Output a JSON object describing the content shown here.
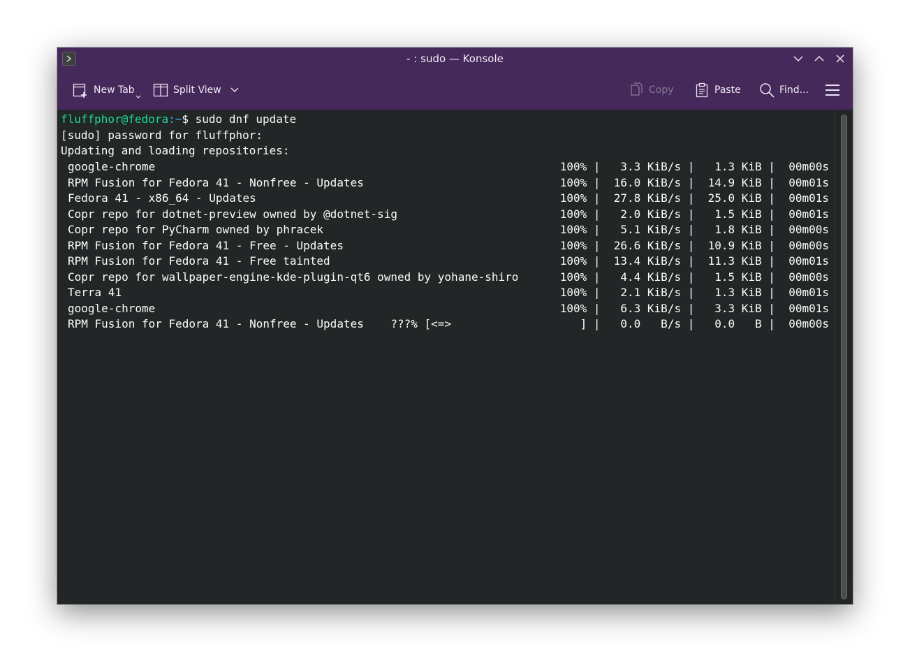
{
  "window": {
    "title": "- : sudo — Konsole"
  },
  "toolbar": {
    "new_tab_label": "New Tab",
    "split_view_label": "Split View",
    "copy_label": "Copy",
    "paste_label": "Paste",
    "find_label": "Find..."
  },
  "terminal": {
    "prompt_user": "fluffphor@fedora",
    "prompt_path": ":~",
    "prompt_symbol": "$",
    "command": " sudo dnf update",
    "line_password": "[sudo] password for fluffphor:",
    "line_updating": "Updating and loading repositories:",
    "repos": [
      {
        "name": "google-chrome",
        "stats": "100% |   3.3 KiB/s |   1.3 KiB |  00m00s"
      },
      {
        "name": "RPM Fusion for Fedora 41 - Nonfree - Updates",
        "stats": "100% |  16.0 KiB/s |  14.9 KiB |  00m01s"
      },
      {
        "name": "Fedora 41 - x86_64 - Updates",
        "stats": "100% |  27.8 KiB/s |  25.0 KiB |  00m01s"
      },
      {
        "name": "Copr repo for dotnet-preview owned by @dotnet-sig",
        "stats": "100% |   2.0 KiB/s |   1.5 KiB |  00m01s"
      },
      {
        "name": "Copr repo for PyCharm owned by phracek",
        "stats": "100% |   5.1 KiB/s |   1.8 KiB |  00m00s"
      },
      {
        "name": "RPM Fusion for Fedora 41 - Free - Updates",
        "stats": "100% |  26.6 KiB/s |  10.9 KiB |  00m00s"
      },
      {
        "name": "RPM Fusion for Fedora 41 - Free tainted",
        "stats": "100% |  13.4 KiB/s |  11.3 KiB |  00m01s"
      },
      {
        "name": "Copr repo for wallpaper-engine-kde-plugin-qt6 owned by yohane-shiro",
        "stats": "100% |   4.4 KiB/s |   1.5 KiB |  00m00s"
      },
      {
        "name": "Terra 41",
        "stats": "100% |   2.1 KiB/s |   1.3 KiB |  00m01s"
      },
      {
        "name": "google-chrome",
        "stats": "100% |   6.3 KiB/s |   3.3 KiB |  00m01s"
      },
      {
        "name": "RPM Fusion for Fedora 41 - Nonfree - Updates    ???% [<=>",
        "stats": "   ] |   0.0   B/s |   0.0   B |  00m00s"
      }
    ]
  },
  "colors": {
    "titlebar": "#45295a",
    "terminal_bg": "#232627",
    "prompt_user": "#1cdc9a",
    "prompt_path": "#3daee9"
  },
  "icons": {
    "app": "konsole-prompt-icon",
    "minimize": "chevron-down-icon",
    "maximize": "chevron-up-icon",
    "close": "close-icon",
    "new_tab": "new-tab-icon",
    "split_view": "split-view-icon",
    "copy": "copy-icon",
    "paste": "paste-icon",
    "find": "search-icon",
    "menu": "hamburger-menu-icon"
  }
}
